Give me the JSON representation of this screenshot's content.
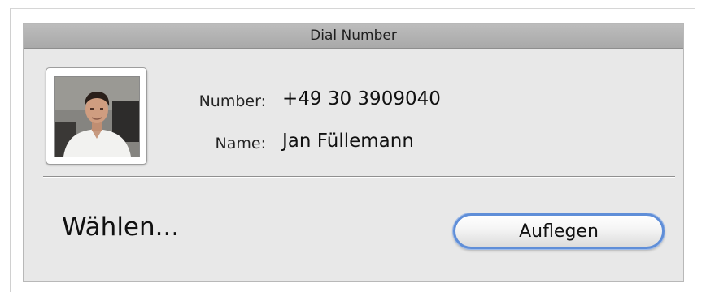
{
  "window": {
    "title": "Dial Number"
  },
  "contact": {
    "number_label": "Number:",
    "number_value": "+49 30 3909040",
    "name_label": "Name:",
    "name_value": "Jan Füllemann"
  },
  "status": {
    "text": "Wählen..."
  },
  "buttons": {
    "hangup_label": "Auflegen"
  }
}
